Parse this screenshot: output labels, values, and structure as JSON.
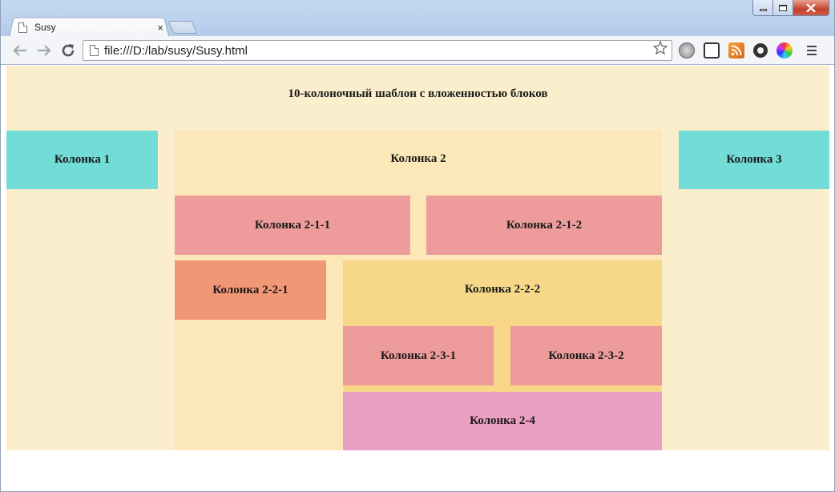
{
  "browser": {
    "tab_title": "Susy",
    "tab_close": "×",
    "url": "file:///D:/lab/susy/Susy.html"
  },
  "page": {
    "title": "10-колоночный шаблон с вложенностью блоков",
    "col1": "Колонка 1",
    "col2": "Колонка 2",
    "col3": "Колонка 3",
    "col2_1_1": "Колонка 2-1-1",
    "col2_1_2": "Колонка 2-1-2",
    "col2_2_1": "Колонка 2-2-1",
    "col2_2_2": "Колонка 2-2-2",
    "col2_3_1": "Колонка 2-3-1",
    "col2_3_2": "Колонка 2-3-2",
    "col2_4": "Колонка 2-4"
  },
  "colors": {
    "page_bg": "#fbeecc",
    "teal": "#72dcd6",
    "wheat": "#fbe7b7",
    "pink": "#ee9c9b",
    "orange": "#f09775",
    "gold": "#f7d888",
    "magenta": "#eb9fc2"
  },
  "icons": {
    "tab": "page-icon",
    "back": "arrow-left-icon",
    "forward": "arrow-right-icon",
    "reload": "reload-icon",
    "bookmark": "star-icon",
    "menu": "hamburger-menu-icon"
  }
}
